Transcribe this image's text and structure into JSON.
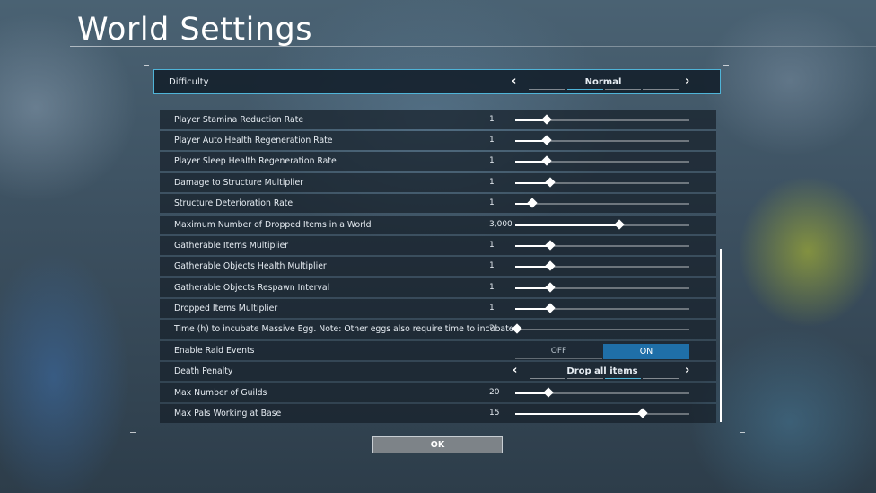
{
  "page": {
    "title": "World Settings"
  },
  "difficulty": {
    "label": "Difficulty",
    "value": "Normal"
  },
  "settings": [
    {
      "label": "Player Stamina Reduction Rate",
      "value": "1",
      "level": 0.18
    },
    {
      "label": "Player Auto Health Regeneration Rate",
      "value": "1",
      "level": 0.18
    },
    {
      "label": "Player Sleep Health Regeneration Rate",
      "value": "1",
      "level": 0.18
    },
    {
      "label": "Damage to Structure Multiplier",
      "value": "1",
      "level": 0.2
    },
    {
      "label": "Structure Deterioration Rate",
      "value": "1",
      "level": 0.1
    },
    {
      "label": "Maximum Number of Dropped Items in a World",
      "value": "3,000",
      "level": 0.6
    },
    {
      "label": "Gatherable Items Multiplier",
      "value": "1",
      "level": 0.2
    },
    {
      "label": "Gatherable Objects Health Multiplier",
      "value": "1",
      "level": 0.2
    },
    {
      "label": "Gatherable Objects Respawn Interval",
      "value": "1",
      "level": 0.2
    },
    {
      "label": "Dropped Items Multiplier",
      "value": "1",
      "level": 0.2
    },
    {
      "label": "Time (h) to incubate Massive Egg. Note: Other eggs also require time to incubate.",
      "value": "2",
      "level": 0.01
    }
  ],
  "raid": {
    "label": "Enable Raid Events",
    "off": "OFF",
    "on": "ON",
    "state": "ON"
  },
  "death_penalty": {
    "label": "Death Penalty",
    "value": "Drop all items"
  },
  "settings2": [
    {
      "label": "Max Number of Guilds",
      "value": "20",
      "level": 0.19
    },
    {
      "label": "Max Pals Working at Base",
      "value": "15",
      "level": 0.73
    }
  ],
  "ok_label": "OK",
  "icons": {
    "prev": "chevron-left-icon",
    "next": "chevron-right-icon"
  }
}
